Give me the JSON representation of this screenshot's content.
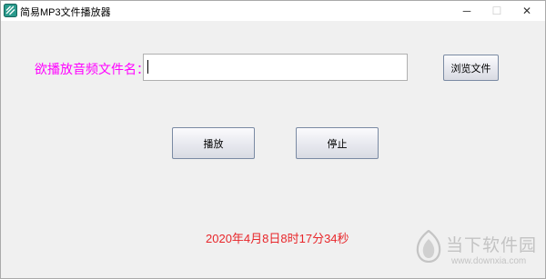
{
  "window": {
    "title": "简易MP3文件播放器",
    "icon": "app-stripes-icon",
    "controls": {
      "minimize": "─",
      "maximize": "☐",
      "close": "✕"
    }
  },
  "form": {
    "file_label": "欲播放音频文件名：",
    "file_input_value": "",
    "browse_label": "浏览文件",
    "play_label": "播放",
    "stop_label": "停止"
  },
  "status": {
    "datetime": "2020年4月8日8时17分34秒"
  },
  "watermark": {
    "text": "当下软件园",
    "url": "www.downxia.com"
  },
  "colors": {
    "label": "#ff00ff",
    "datetime": "#e8262a",
    "watermark": "#b8b8b8",
    "titlebar": "#ffffff",
    "background": "#f0f0f0"
  }
}
